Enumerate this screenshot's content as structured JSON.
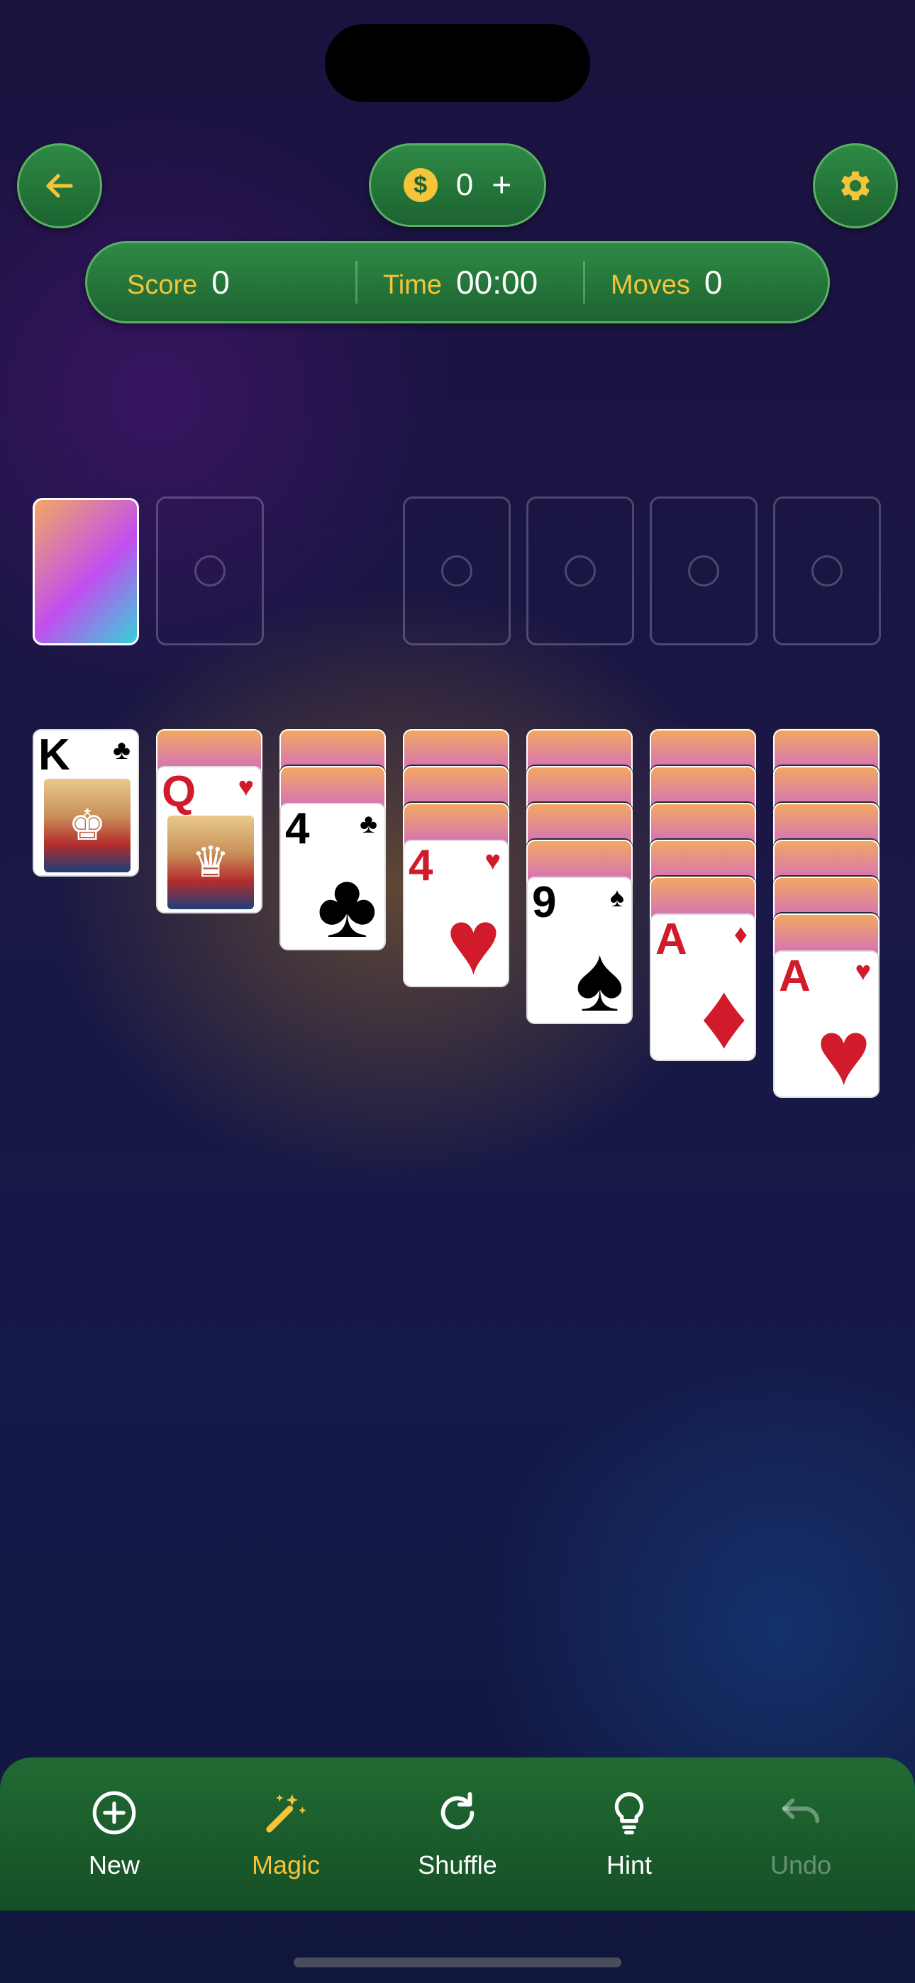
{
  "header": {
    "coins": "0",
    "coin_symbol": "$",
    "coin_plus": "+"
  },
  "stats": {
    "score_label": "Score",
    "score_value": "0",
    "time_label": "Time",
    "time_value": "00:00",
    "moves_label": "Moves",
    "moves_value": "0"
  },
  "tableau": [
    {
      "face_down": 0,
      "face_up": {
        "rank": "K",
        "suit": "♣",
        "color": "black",
        "face_card": true
      }
    },
    {
      "face_down": 1,
      "face_up": {
        "rank": "Q",
        "suit": "♥",
        "color": "red",
        "face_card": true
      }
    },
    {
      "face_down": 2,
      "face_up": {
        "rank": "4",
        "suit": "♣",
        "color": "black",
        "face_card": false
      }
    },
    {
      "face_down": 3,
      "face_up": {
        "rank": "4",
        "suit": "♥",
        "color": "red",
        "face_card": false
      }
    },
    {
      "face_down": 4,
      "face_up": {
        "rank": "9",
        "suit": "♠",
        "color": "black",
        "face_card": false
      }
    },
    {
      "face_down": 5,
      "face_up": {
        "rank": "A",
        "suit": "♦",
        "color": "red",
        "face_card": false
      }
    },
    {
      "face_down": 6,
      "face_up": {
        "rank": "A",
        "suit": "♥",
        "color": "red",
        "face_card": false
      }
    }
  ],
  "toolbar": {
    "new_label": "New",
    "magic_label": "Magic",
    "shuffle_label": "Shuffle",
    "hint_label": "Hint",
    "undo_label": "Undo"
  },
  "colors": {
    "accent_gold": "#f4c43a",
    "button_green": "#2e8a45"
  }
}
